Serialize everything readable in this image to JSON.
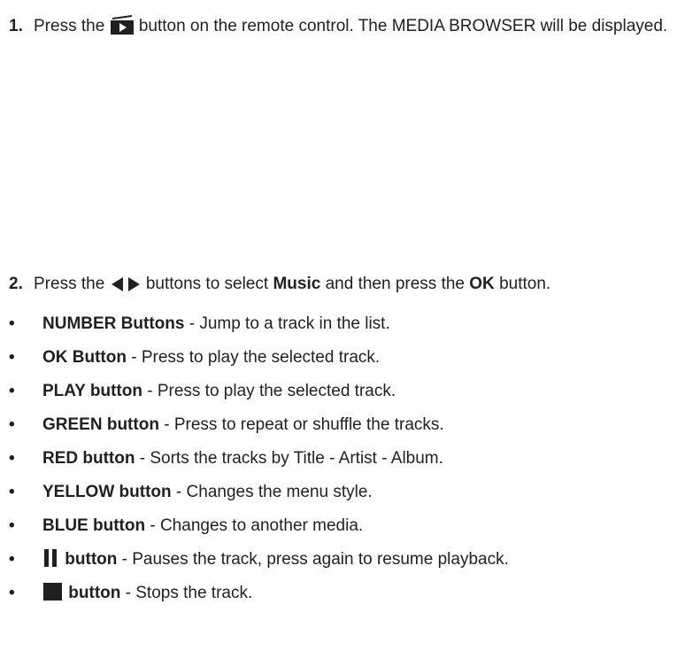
{
  "step1": {
    "number": "1.",
    "before_icon": "Press the",
    "icon": "media-browser-icon",
    "after_icon": "button on the remote control. The MEDIA BROWSER will be displayed."
  },
  "step2": {
    "number": "2.",
    "before_icon": "Press the",
    "icon": "left-right-arrows-icon",
    "text_a": "buttons to select",
    "bold_a": "Music",
    "text_b": "and then press the",
    "bold_b": "OK",
    "text_c": "button."
  },
  "bullet_symbol": "•",
  "bullets": [
    {
      "bold": "NUMBER Buttons",
      "text": " - Jump to a track in the list."
    },
    {
      "bold": "OK Button",
      "text": " - Press to play the selected track."
    },
    {
      "bold": "PLAY button",
      "text": " - Press to play the selected track."
    },
    {
      "bold": "GREEN button",
      "text": " - Press to repeat or shuffle the tracks."
    },
    {
      "bold": "RED button",
      "text": " - Sorts the tracks by Title - Artist - Album."
    },
    {
      "bold": "YELLOW button",
      "text": " - Changes the menu style."
    },
    {
      "bold": "BLUE button",
      "text": " - Changes to another media."
    },
    {
      "icon": "pause-icon",
      "bold": "button",
      "text": " - Pauses the track, press again to resume playback."
    },
    {
      "icon": "stop-icon",
      "bold": "button",
      "text": " - Stops the track."
    }
  ],
  "colors": {
    "text": "#231f20"
  }
}
